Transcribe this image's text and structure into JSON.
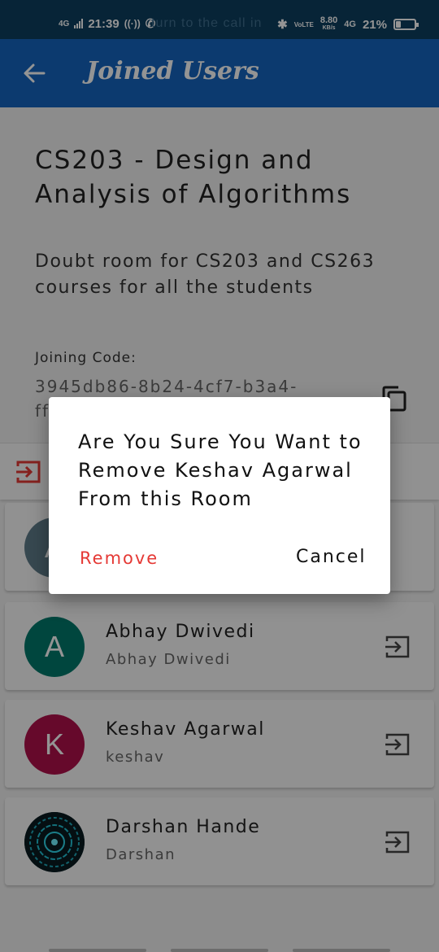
{
  "status_bar": {
    "network": "4G",
    "time": "21:39",
    "ghost_text": "turn to the call in",
    "volte": "VoLTE",
    "speed": "8.80",
    "speed_unit": "KB/s",
    "network2": "4G",
    "battery": "21%"
  },
  "app_bar": {
    "title": "Joined Users",
    "back_icon": "back-arrow-icon"
  },
  "room": {
    "title": "CS203 - Design and Analysis of Algorithms",
    "description": "Doubt room for CS203 and CS263 courses for all the students",
    "code_label": "Joining Code:",
    "code_value": "3945db86-8b24-4cf7-b3a4-ff",
    "copy_icon": "copy-icon"
  },
  "users": [
    {
      "initial": "A",
      "name": "",
      "sub": "",
      "color": "#607d8b"
    },
    {
      "initial": "A",
      "name": "Abhay Dwivedi",
      "sub": "Abhay Dwivedi",
      "color": "#00796b"
    },
    {
      "initial": "K",
      "name": "Keshav Agarwal",
      "sub": "keshav",
      "color": "#b0104a"
    },
    {
      "initial": "",
      "name": "Darshan Hande",
      "sub": "Darshan",
      "color": "#0b2a33"
    }
  ],
  "icons": {
    "leave": "exit-icon",
    "remove_user": "exit-icon"
  },
  "colors": {
    "app_bar": "#1565c0",
    "status_bar": "#0d3f60",
    "remove": "#e53935"
  },
  "dialog": {
    "message": "Are You Sure You Want to Remove Keshav Agarwal From this Room",
    "remove_label": "Remove",
    "cancel_label": "Cancel"
  }
}
